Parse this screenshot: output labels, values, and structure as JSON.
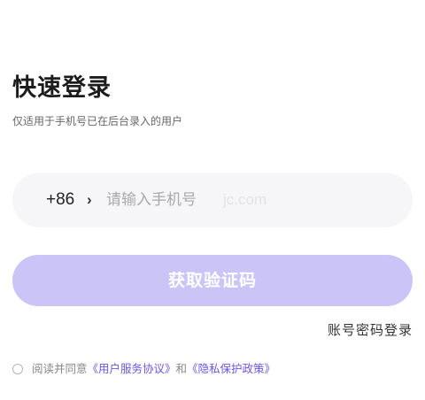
{
  "header": {
    "title": "快速登录",
    "subtitle": "仅适用于手机号已在后台录入的用户"
  },
  "phone": {
    "country_code": "+86",
    "chevron": "›",
    "placeholder": "请输入手机号",
    "watermark": "jc.com"
  },
  "actions": {
    "get_code": "获取验证码",
    "password_login": "账号密码登录"
  },
  "agreement": {
    "prefix": "阅读并同意",
    "user_agreement": "《用户服务协议》",
    "conjunction": "和",
    "privacy_policy": "《隐私保护政策》"
  },
  "colors": {
    "accent": "#6a55e8",
    "button_disabled": "#cbc5f7",
    "input_bg": "#f6f6f8"
  },
  "icons": {
    "country_chevron": "chevron-right-icon",
    "agreement_radio": "radio-unchecked-icon"
  }
}
